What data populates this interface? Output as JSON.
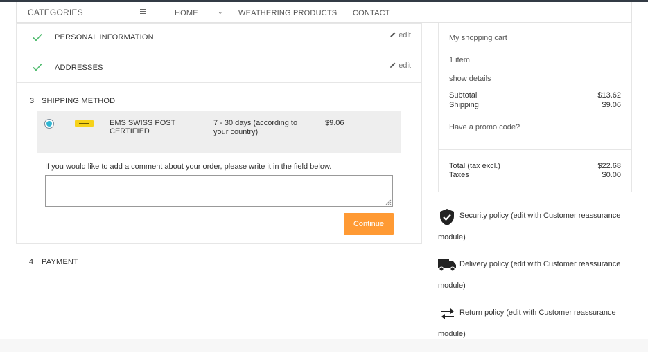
{
  "nav": {
    "categories_label": "CATEGORIES",
    "items": [
      "HOME",
      "WEATHERING PRODUCTS",
      "CONTACT"
    ]
  },
  "steps": {
    "personal": {
      "title": "PERSONAL INFORMATION",
      "edit": "edit"
    },
    "addresses": {
      "title": "ADDRESSES",
      "edit": "edit"
    },
    "shipping": {
      "number": "3",
      "title": "SHIPPING METHOD"
    },
    "payment": {
      "number": "4",
      "title": "PAYMENT"
    }
  },
  "carrier": {
    "name": "EMS SWISS POST CERTIFIED",
    "delay": "7 - 30 days (according to your country)",
    "price": "$9.06",
    "selected": true,
    "logo_icon": "ems-swiss-post-logo"
  },
  "comment": {
    "label": "If you would like to add a comment about your order, please write it in the field below.",
    "value": ""
  },
  "continue_label": "Continue",
  "cart": {
    "title": "My shopping cart",
    "items_count": "1 item",
    "show_details": "show details",
    "subtotal_label": "Subtotal",
    "subtotal_value": "$13.62",
    "shipping_label": "Shipping",
    "shipping_value": "$9.06",
    "promo": "Have a promo code?",
    "total_label": "Total (tax excl.)",
    "total_value": "$22.68",
    "taxes_label": "Taxes",
    "taxes_value": "$0.00"
  },
  "reassurance": [
    {
      "icon": "shield-check-icon",
      "text": "Security policy (edit with Customer reassurance module)"
    },
    {
      "icon": "truck-icon",
      "text": "Delivery policy (edit with Customer reassurance module)"
    },
    {
      "icon": "swap-arrows-icon",
      "text": "Return policy (edit with Customer reassurance module)"
    }
  ],
  "colors": {
    "accent": "#2fb5d2",
    "check": "#4cbb6c",
    "continue_button": "#ff9a34",
    "top_bar": "#333b45"
  }
}
